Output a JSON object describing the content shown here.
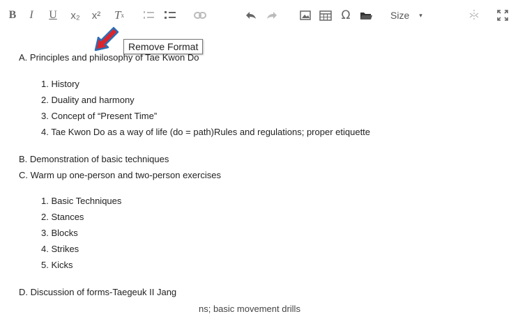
{
  "toolbar": {
    "buttons": [
      {
        "name": "bold",
        "label": "B"
      },
      {
        "name": "italic",
        "label": "I"
      },
      {
        "name": "underline",
        "label": "U"
      },
      {
        "name": "subscript",
        "label": "x₂"
      },
      {
        "name": "superscript",
        "label": "x²"
      },
      {
        "name": "remove-format",
        "label": "T"
      },
      {
        "name": "numbered-list",
        "icon": "numbered-list-icon"
      },
      {
        "name": "bulleted-list",
        "icon": "bulleted-list-icon"
      },
      {
        "name": "link",
        "icon": "link-icon"
      },
      {
        "name": "undo",
        "icon": "undo-icon"
      },
      {
        "name": "redo",
        "icon": "redo-icon"
      },
      {
        "name": "image",
        "icon": "image-icon"
      },
      {
        "name": "table",
        "icon": "table-icon"
      },
      {
        "name": "special-character",
        "icon": "omega-icon"
      },
      {
        "name": "folder",
        "icon": "folder-icon"
      },
      {
        "name": "show-blocks",
        "icon": "show-blocks-icon"
      },
      {
        "name": "maximize",
        "icon": "maximize-icon"
      }
    ],
    "remove_format_sub": "x",
    "size_label": "Size",
    "size_caret": "▾",
    "tooltip": "Remove Format"
  },
  "content": {
    "section_a": "A. Principles and philosophy of Tae Kwon Do",
    "section_a_items": [
      "1. History",
      "2. Duality and harmony",
      "3. Concept of “Present Time”",
      "4. Tae Kwon Do as a way of life (do = path)Rules and regulations; proper etiquette"
    ],
    "section_b": "B. Demonstration of basic techniques",
    "section_c": "C. Warm up one-person and two-person exercises",
    "section_c_items": [
      "1.  Basic Techniques",
      "2. Stances",
      "3. Blocks",
      "4. Strikes",
      "5. Kicks"
    ],
    "section_d": "D. Discussion of forms-Taegeuk II Jang",
    "cutoff_line": "ns; basic movement drills"
  },
  "colors": {
    "pointer_arrow": "#d9262e",
    "pointer_outline": "#2b6fb6",
    "toolbar_icon": "#666666",
    "toolbar_icon_disabled": "#bbbbbb"
  }
}
